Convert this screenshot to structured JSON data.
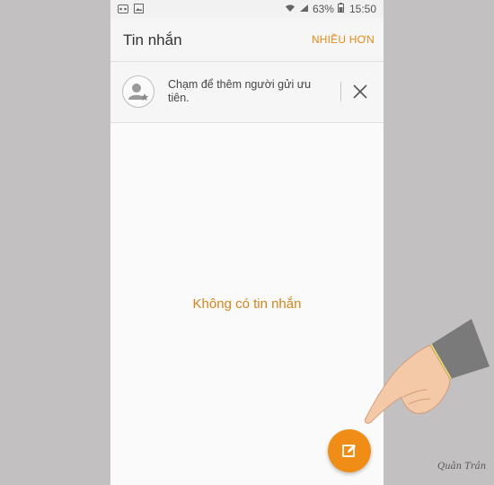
{
  "status_bar": {
    "battery_percent": "63%",
    "time": "15:50",
    "icons": [
      "voicemail-icon",
      "image-icon",
      "wifi-icon",
      "signal-icon",
      "battery-icon"
    ]
  },
  "app_bar": {
    "title": "Tin nhắn",
    "more_label": "NHIỀU HƠN"
  },
  "priority_banner": {
    "text": "Chạm để thêm người gửi ưu tiên.",
    "icons": [
      "priority-contact-icon",
      "close-icon"
    ]
  },
  "main": {
    "empty_message": "Không có tin nhắn"
  },
  "fab": {
    "icon": "compose-icon"
  },
  "colors": {
    "accent": "#e8891a",
    "fab": "#ef8d17",
    "background": "#c3c0c1"
  },
  "watermark": "Quân Trần"
}
